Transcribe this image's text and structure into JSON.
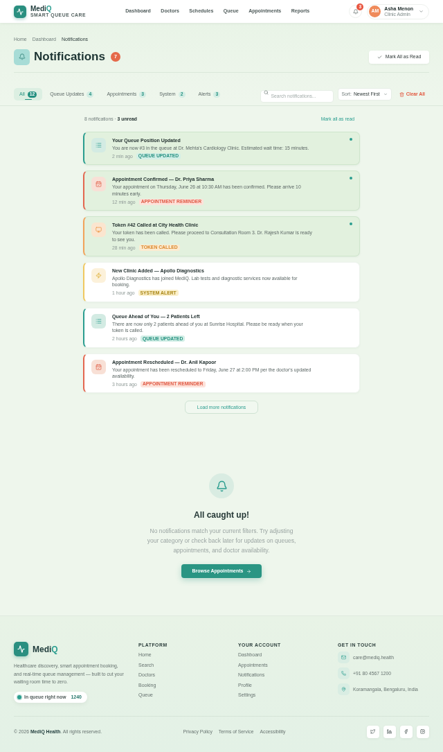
{
  "header": {
    "brand": {
      "name": "Medi",
      "accent": "Q",
      "tagline": "SMART QUEUE CARE"
    },
    "nav": [
      "Dashboard",
      "Doctors",
      "Schedules",
      "Queue",
      "Appointments",
      "Reports"
    ],
    "alerts_badge": "3",
    "user": {
      "initials": "AM",
      "name": "Asha Menon",
      "role": "Clinic Admin"
    }
  },
  "breadcrumb": [
    "Home",
    "Dashboard",
    "Notifications"
  ],
  "page_header": {
    "title": "Notifications",
    "count_badge": "7",
    "mark_all_button": "Mark All as Read"
  },
  "filters": {
    "tabs": [
      {
        "label": "All",
        "count": "12",
        "selected": true
      },
      {
        "label": "Queue Updates",
        "count": "4",
        "selected": false
      },
      {
        "label": "Appointments",
        "count": "3",
        "selected": false
      },
      {
        "label": "System",
        "count": "2",
        "selected": false
      },
      {
        "label": "Alerts",
        "count": "3",
        "selected": false
      }
    ],
    "search": {
      "placeholder": "Search notifications..."
    },
    "sort": {
      "label": "Sort:",
      "value": "Newest First"
    },
    "clear_button": "Clear All"
  },
  "notifications": {
    "summary": "8 notifications · **3 unread**",
    "mark_all_link": "Mark all as read",
    "items": [
      {
        "kind": "queue",
        "title": "Your Queue Position Updated",
        "message": "You are now #3 in the queue at Dr. Mehta's Cardiology Clinic. Estimated wait time: 15 minutes.",
        "time": "2 min ago",
        "tag": "QUEUE UPDATED",
        "unread": true
      },
      {
        "kind": "appointment",
        "title": "Appointment Confirmed — Dr. Priya Sharma",
        "message": "Your appointment on Thursday, June 26 at 10:30 AM has been confirmed. Please arrive 10 minutes early.",
        "time": "12 min ago",
        "tag": "APPOINTMENT REMINDER",
        "unread": true
      },
      {
        "kind": "token",
        "title": "Token #42 Called at City Health Clinic",
        "message": "Your token has been called. Please proceed to Consultation Room 3. Dr. Rajesh Kumar is ready to see you.",
        "time": "28 min ago",
        "tag": "TOKEN CALLED",
        "unread": true
      },
      {
        "kind": "system",
        "title": "New Clinic Added — Apollo Diagnostics",
        "message": "Apollo Diagnostics has joined MediQ. Lab tests and diagnostic services now available for booking.",
        "time": "1 hour ago",
        "tag": "SYSTEM ALERT",
        "unread": false
      },
      {
        "kind": "queue",
        "title": "Queue Ahead of You — 2 Patients Left",
        "message": "There are now only 2 patients ahead of you at Sunrise Hospital. Please be ready when your token is called.",
        "time": "2 hours ago",
        "tag": "QUEUE UPDATED",
        "unread": false
      },
      {
        "kind": "appointment",
        "title": "Appointment Rescheduled — Dr. Anil Kapoor",
        "message": "Your appointment has been rescheduled to Friday, June 27 at 2:00 PM per the doctor's updated availability.",
        "time": "3 hours ago",
        "tag": "APPOINTMENT REMINDER",
        "unread": false
      }
    ],
    "load_more_button": "Load more notifications"
  },
  "empty_state": {
    "title": "All caught up!",
    "message": "No notifications match your current filters. Try adjusting your category or check back later for updates on queues, appointments, and doctor availability.",
    "button": "Browse Appointments"
  },
  "footer": {
    "brand": {
      "name": "Medi",
      "accent": "Q"
    },
    "description": "Healthcare discovery, smart appointment booking, and real-time queue management — built to cut your waiting room time to zero.",
    "live_pill": {
      "label": "In queue right now",
      "count": "1240"
    },
    "columns": [
      {
        "heading": "PLATFORM",
        "links": [
          "Home",
          "Search",
          "Doctors",
          "Booking",
          "Queue"
        ]
      },
      {
        "heading": "YOUR ACCOUNT",
        "links": [
          "Dashboard",
          "Appointments",
          "Notifications",
          "Profile",
          "Settings"
        ]
      }
    ],
    "contact": {
      "heading": "GET IN TOUCH",
      "items": [
        {
          "kind": "email",
          "text": "care@mediq.health"
        },
        {
          "kind": "phone",
          "text": "+91 80 4567 1200"
        },
        {
          "kind": "location",
          "text": "Koramangala, Bengaluru, India"
        }
      ]
    },
    "copyright": "© 2026 **MediQ Health**. All rights reserved.",
    "legal_links": [
      "Privacy Policy",
      "Terms of Service",
      "Accessibility"
    ],
    "social": [
      {
        "kind": "twitter"
      },
      {
        "kind": "linkedin"
      },
      {
        "kind": "facebook"
      },
      {
        "kind": "instagram"
      }
    ]
  }
}
